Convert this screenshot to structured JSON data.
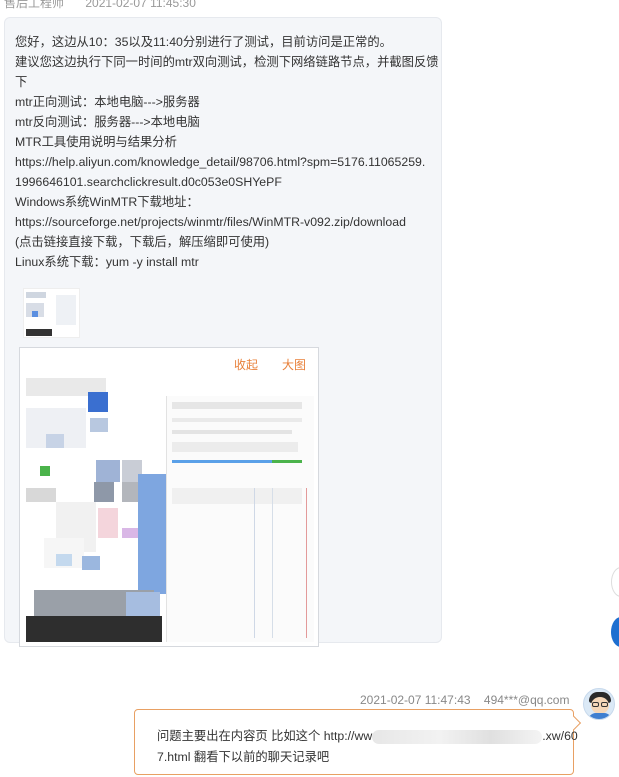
{
  "top_meta": {
    "sender": "售后工程师",
    "timestamp": "2021-02-07 11:45:30"
  },
  "incoming_message": {
    "lines": [
      "您好，这边从10：35以及11:40分别进行了测试，目前访问是正常的。",
      "建议您这边执行下同一时间的mtr双向测试，检测下网络链路节点，并截图反馈",
      "下",
      "mtr正向测试：本地电脑--->服务器",
      "mtr反向测试：服务器--->本地电脑",
      "MTR工具使用说明与结果分析",
      "https://help.aliyun.com/knowledge_detail/98706.html?spm=5176.11065259.",
      "1996646101.searchclickresult.d0c053e0SHYePF",
      "Windows系统WinMTR下载地址：",
      "https://sourceforge.net/projects/winmtr/files/WinMTR-v092.zip/download",
      "(点击链接直接下载，下载后，解压缩即可使用)",
      "Linux系统下载：yum -y install mtr"
    ],
    "image_actions": {
      "collapse": "收起",
      "enlarge": "大图"
    }
  },
  "outgoing_message": {
    "timestamp": "2021-02-07 11:47:43",
    "email": "494***@qq.com",
    "line1_prefix": "问题主要出在内容页 比如这个 http://ww",
    "line1_suffix": ".xw/60",
    "line2": "7.html 翻看下以前的聊天记录吧"
  },
  "colors": {
    "action": "#e8803a",
    "bubble_border": "#e8a063",
    "side_control": "#1e6fd0"
  }
}
